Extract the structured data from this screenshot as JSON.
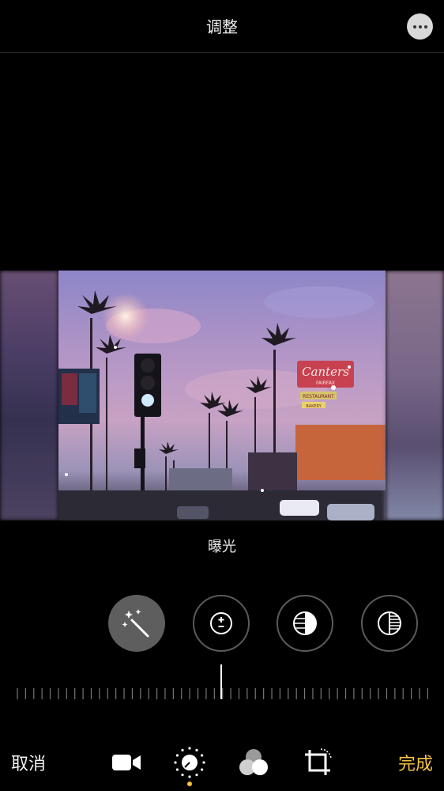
{
  "header": {
    "title": "调整"
  },
  "photo": {
    "sign_text": "Canters",
    "sign_sub": "FAIRFAX",
    "restaurant": "RESTAURANT",
    "bakery": "BAKERY"
  },
  "adjust": {
    "current_label": "曝光"
  },
  "tools": [
    {
      "name": "auto-enhance",
      "icon": "magic-wand-icon",
      "active": true
    },
    {
      "name": "exposure",
      "icon": "exposure-icon"
    },
    {
      "name": "brilliance",
      "icon": "brilliance-icon"
    },
    {
      "name": "highlights",
      "icon": "highlights-icon"
    }
  ],
  "bottom": {
    "cancel": "取消",
    "done": "完成"
  },
  "colors": {
    "accent": "#f5c344",
    "background": "#000000"
  }
}
